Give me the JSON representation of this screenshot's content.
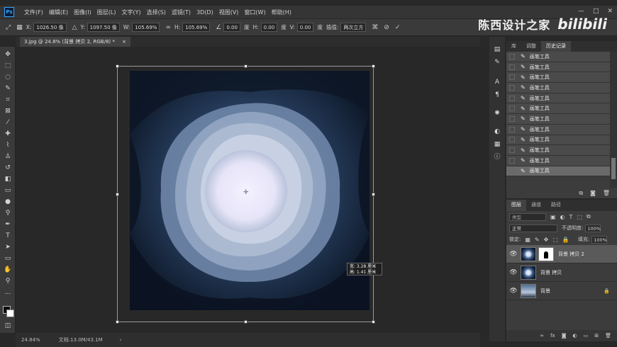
{
  "menubar": {
    "logo": "Ps",
    "items": [
      "文件(F)",
      "编辑(E)",
      "图像(I)",
      "图层(L)",
      "文字(Y)",
      "选择(S)",
      "滤镜(T)",
      "3D(D)",
      "视图(V)",
      "窗口(W)",
      "帮助(H)"
    ],
    "window_controls": [
      "—",
      "□",
      "✕"
    ]
  },
  "options_bar": {
    "x_label": "X:",
    "x_value": "1026.50 像",
    "y_label": "Y:",
    "y_value": "1097.50 像",
    "w_label": "W:",
    "w_value": "105.69%",
    "h_label": "H:",
    "h_value": "105.69%",
    "angle_value": "0.00",
    "angle_unit": "度",
    "hskew_label": "H:",
    "hskew_value": "0.00",
    "hskew_unit": "度",
    "vskew_label": "V:",
    "vskew_value": "0.00",
    "vskew_unit": "度",
    "interp_label": "插值:",
    "interp_value": "两次立方"
  },
  "watermark": {
    "text": "陈西设计之家",
    "logo": "bilibili"
  },
  "document_tab": {
    "label": "3.jpg @ 24.8% (背景 拷贝 2, RGB/8) *",
    "close": "×"
  },
  "tooltip": {
    "w_line": "宽: 3.28 厘米",
    "h_line": "高: 1.41 厘米"
  },
  "status": {
    "zoom": "24.84%",
    "doc": "文档:13.0M/43.1M",
    "arrow": "›"
  },
  "history_panel": {
    "tabs": [
      "库",
      "调整",
      "历史记录"
    ],
    "entry_label": "画笔工具",
    "row_count": 12,
    "selected_index": 11
  },
  "layers_panel": {
    "tabs": [
      "图层",
      "通道",
      "路径"
    ],
    "kind_label": "类型",
    "blend_mode": "正常",
    "opacity_label": "不透明度:",
    "opacity_value": "100%",
    "lock_label": "锁定:",
    "fill_label": "填充:",
    "fill_value": "100%",
    "layers": [
      {
        "name": "背景 拷贝 2",
        "selected": true
      },
      {
        "name": "背景 拷贝",
        "selected": false
      },
      {
        "name": "背景",
        "selected": false
      }
    ]
  },
  "colors": {
    "accent": "#31a8ff",
    "workspace": "#282828",
    "panel": "#3c3c3c"
  }
}
